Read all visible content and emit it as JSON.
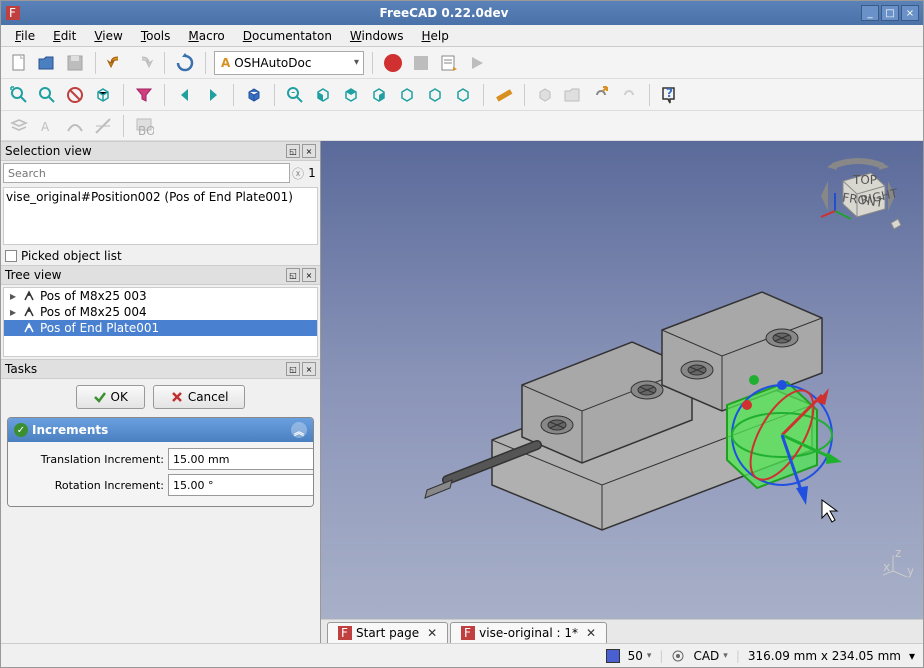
{
  "titlebar": {
    "title": "FreeCAD 0.22.0dev"
  },
  "menu": {
    "file": "File",
    "edit": "Edit",
    "view": "View",
    "tools": "Tools",
    "macro": "Macro",
    "documentation": "Documentaton",
    "windows": "Windows",
    "help": "Help"
  },
  "toolbar": {
    "workbench": "OSHAutoDoc"
  },
  "panes": {
    "selection_view": "Selection view",
    "tree_view": "Tree view",
    "tasks": "Tasks"
  },
  "search": {
    "placeholder": "Search",
    "count": "1"
  },
  "selection_item": "vise_original#Position002 (Pos of End Plate001)",
  "picked_label": "Picked object list",
  "tree": {
    "items": [
      {
        "label": "Pos of M8x25 003",
        "selected": false
      },
      {
        "label": "Pos of M8x25 004",
        "selected": false
      },
      {
        "label": "Pos of End Plate001",
        "selected": true
      }
    ]
  },
  "tasks": {
    "ok": "OK",
    "cancel": "Cancel",
    "section_title": "Increments",
    "translation_label": "Translation Increment:",
    "translation_value": "15.00 mm",
    "rotation_label": "Rotation Increment:",
    "rotation_value": "15.00 °"
  },
  "navcube": {
    "top": "TOP",
    "front": "FRONT",
    "right": "RIGHT"
  },
  "tabs": {
    "start": "Start page",
    "doc": "vise-original : 1*"
  },
  "status": {
    "value": "50",
    "mode": "CAD",
    "dims": "316.09 mm x 234.05 mm"
  }
}
